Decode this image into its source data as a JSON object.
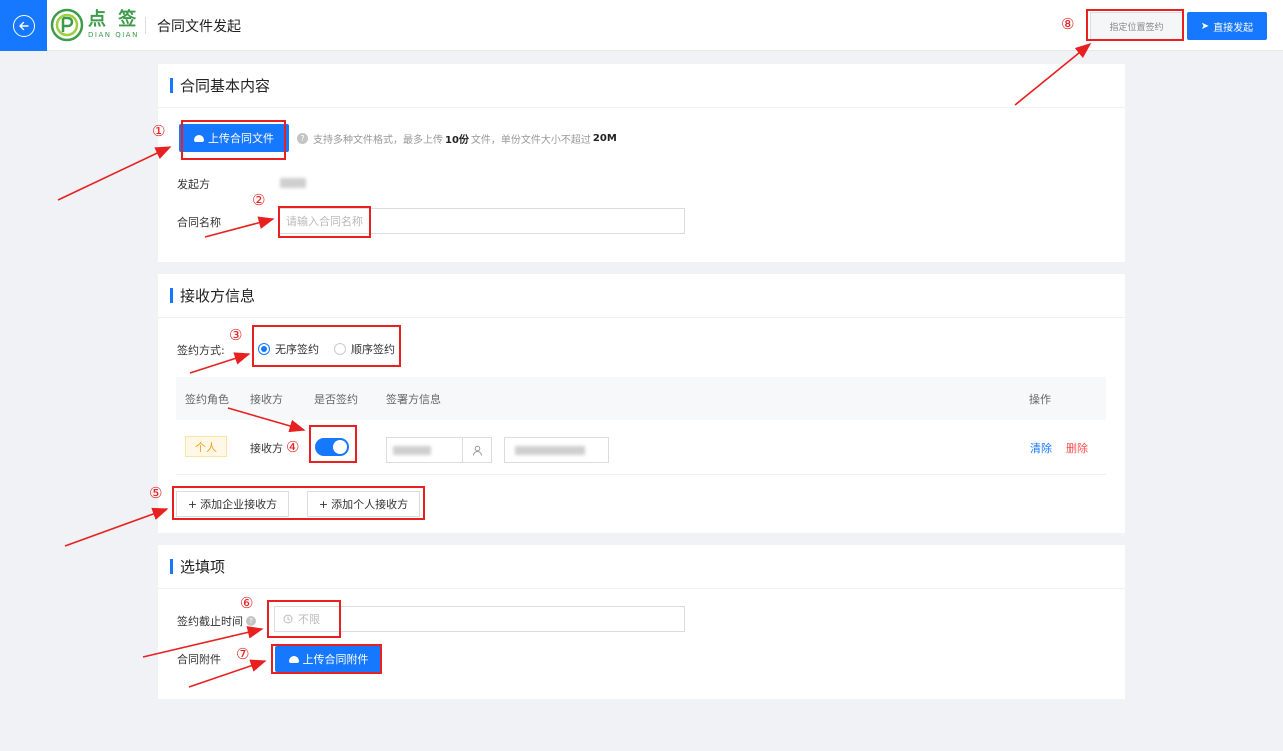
{
  "header": {
    "brand_cn": "点 签",
    "brand_en": "DIAN QIAN",
    "page_title": "合同文件发起",
    "btn_specify_position": "指定位置签约",
    "btn_direct_start": "直接发起"
  },
  "basic": {
    "title": "合同基本内容",
    "upload_label": "上传合同文件",
    "hint_prefix": "支持多种文件格式，最多上传",
    "hint_count": "10份",
    "hint_mid": "文件，单份文件大小不超过",
    "hint_size": "20M",
    "initiator_label": "发起方",
    "name_label": "合同名称",
    "name_placeholder": "请输入合同名称"
  },
  "receiver": {
    "title": "接收方信息",
    "sign_mode_label": "签约方式:",
    "mode_unordered": "无序签约",
    "mode_ordered": "顺序签约",
    "selected_mode": "无序签约",
    "columns": [
      "签约角色",
      "接收方",
      "是否签约",
      "签署方信息",
      "操作"
    ],
    "rows": [
      {
        "role": "个人",
        "receiver": "接收方",
        "sign_enabled": true,
        "action_clear": "清除",
        "action_delete": "删除"
      }
    ],
    "add_company": "添加企业接收方",
    "add_person": "添加个人接收方"
  },
  "optional": {
    "title": "选填项",
    "deadline_label": "签约截止时间",
    "deadline_value": "不限",
    "attachment_label": "合同附件",
    "upload_attachment": "上传合同附件"
  },
  "annotations": [
    "①",
    "②",
    "③",
    "④",
    "⑤",
    "⑥",
    "⑦",
    "⑧"
  ],
  "colors": {
    "primary": "#1677ff",
    "annotation": "#e82020",
    "brand": "#3d9b4a",
    "danger": "#ff4d4f"
  }
}
